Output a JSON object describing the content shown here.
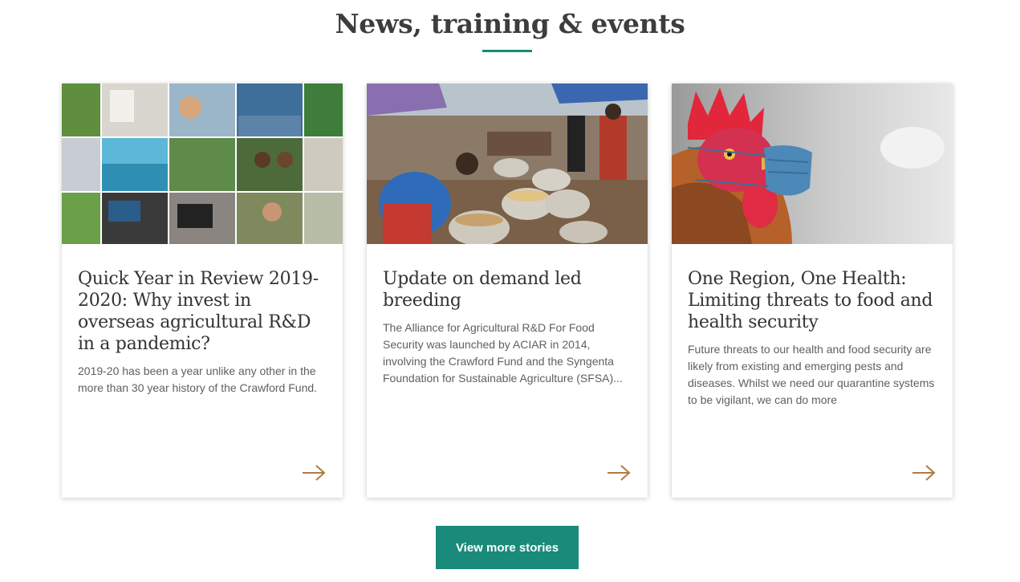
{
  "section": {
    "title": "News, training & events"
  },
  "cards": [
    {
      "title": "Quick Year in Review 2019-2020: Why invest in overseas agricultural R&D in a pandemic?",
      "excerpt": "2019-20 has been a year unlike any other in the more than 30 year history of the Crawford Fund.",
      "image": "photo-collage-of-people",
      "link_icon": "arrow-right-icon"
    },
    {
      "title": "Update on demand led breeding",
      "excerpt": "The Alliance for Agricultural R&D For Food Security was launched by ACIAR in 2014, involving the Crawford Fund and the Syngenta Foundation for Sustainable Agriculture (SFSA)...",
      "image": "market-grain-sacks-photo",
      "link_icon": "arrow-right-icon"
    },
    {
      "title": "One Region, One Health: Limiting threats to food and health security",
      "excerpt": "Future threats to our health and food security are likely from existing and emerging pests and diseases. Whilst we need our quarantine systems to be vigilant, we can do more",
      "image": "rooster-with-face-mask-photo",
      "link_icon": "arrow-right-icon"
    }
  ],
  "cta": {
    "label": "View more stories"
  },
  "colors": {
    "accent": "#1a8a7a",
    "arrow": "#b07a45",
    "heading": "#3d3d3d",
    "body_text": "#606060"
  }
}
